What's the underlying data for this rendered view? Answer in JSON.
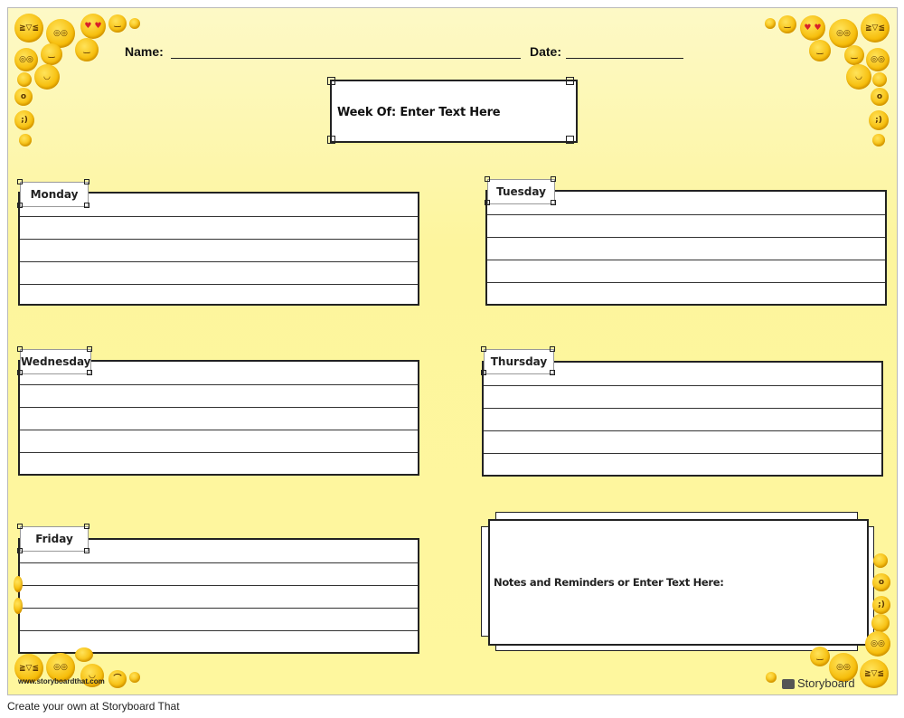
{
  "header": {
    "name_label": "Name:",
    "date_label": "Date:"
  },
  "week": {
    "label": "Week Of: Enter Text Here"
  },
  "days": [
    {
      "label": "Monday"
    },
    {
      "label": "Tuesday"
    },
    {
      "label": "Wednesday"
    },
    {
      "label": "Thursday"
    },
    {
      "label": "Friday"
    }
  ],
  "notes": {
    "label": "Notes and Reminders or Enter Text Here:"
  },
  "branding": {
    "watermark_url": "www.storyboardthat.com",
    "logo_text": "Storyboard",
    "footer": "Create your own at Storyboard That"
  },
  "colors": {
    "background_top": "#fdf9c6",
    "background_bottom": "#fef79e",
    "emoji_yellow": "#f5b800",
    "line": "#222222"
  },
  "icons": [
    "laughing-emoji-icon",
    "nerd-emoji-icon",
    "heart-eyes-emoji-icon",
    "smile-emoji-icon",
    "wink-emoji-icon",
    "surprised-emoji-icon"
  ]
}
